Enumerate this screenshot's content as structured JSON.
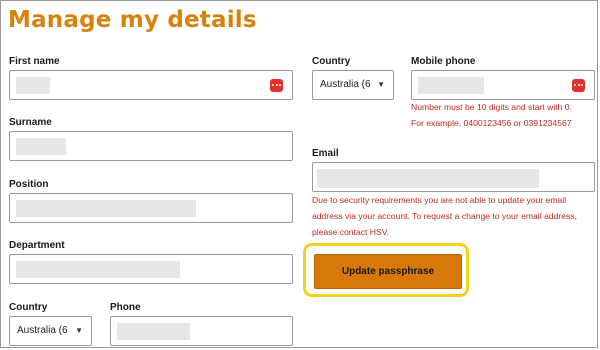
{
  "page": {
    "title": "Manage my details"
  },
  "left": {
    "first_name": {
      "label": "First name"
    },
    "surname": {
      "label": "Surname"
    },
    "position": {
      "label": "Position"
    },
    "department": {
      "label": "Department"
    },
    "country": {
      "label": "Country",
      "value": "Australia (6"
    },
    "phone": {
      "label": "Phone"
    }
  },
  "right": {
    "country": {
      "label": "Country",
      "value": "Australia (6"
    },
    "mobile": {
      "label": "Mobile phone",
      "error_line1": "Number must be 10 digits and start with 0.",
      "error_line2": "For example, 0400123456 or 0391234567"
    },
    "email": {
      "label": "Email",
      "note_line1": "Due to security requirements you are not able to update your email",
      "note_line2": "address via your account. To request a change to your email address,",
      "note_line3": "please contact HSV."
    },
    "update_button": "Update passphrase"
  },
  "colors": {
    "accent": "#d9820a",
    "error": "#c02a1e",
    "highlight": "#f2d21c"
  }
}
